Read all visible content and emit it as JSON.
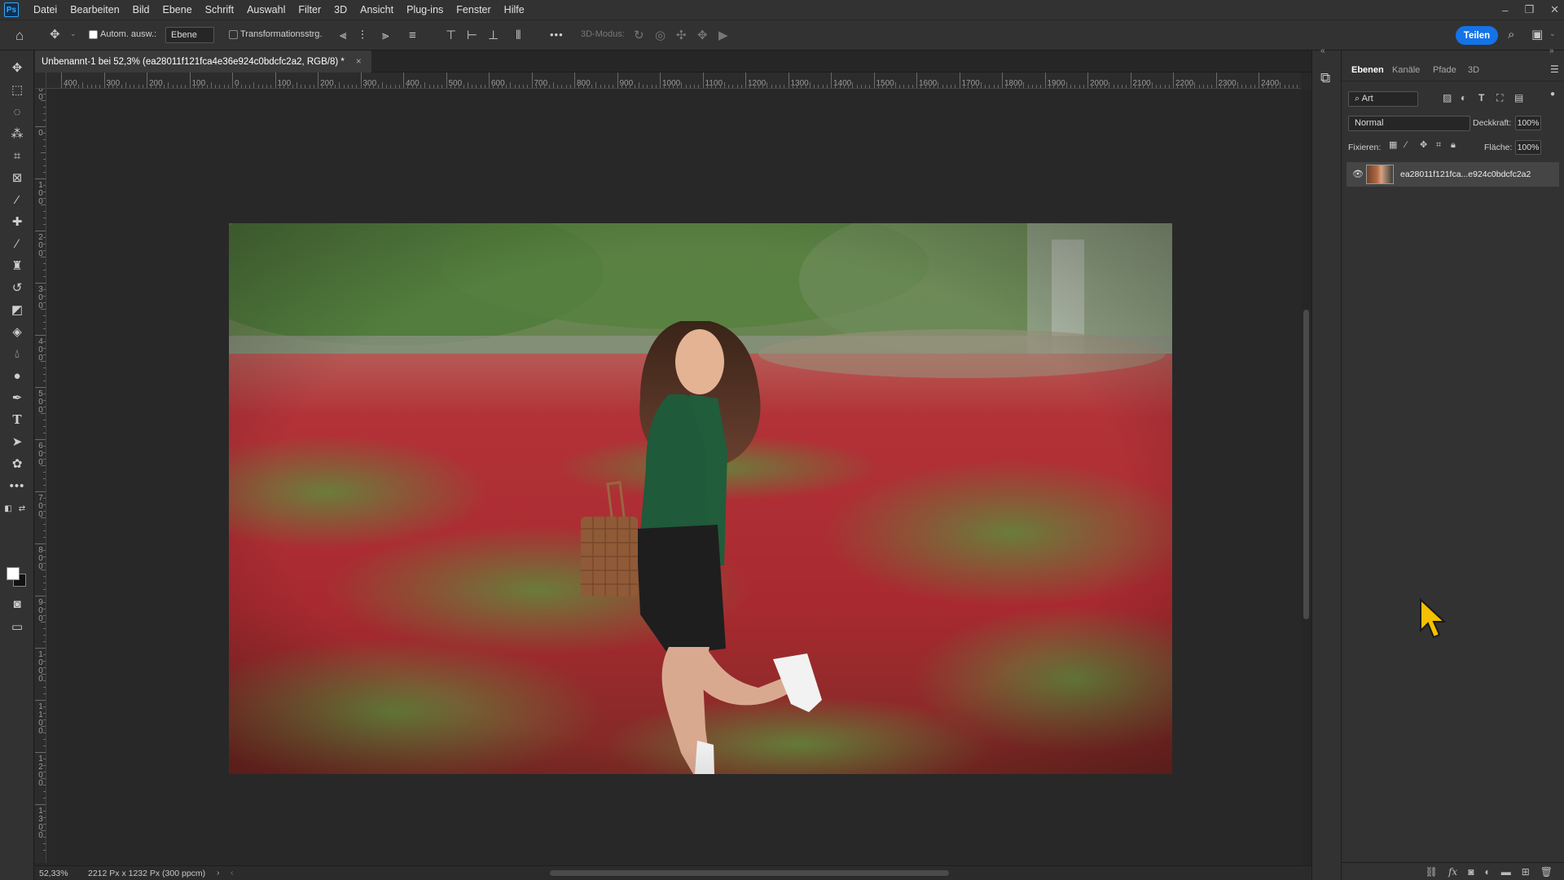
{
  "app": {
    "logo": "Ps"
  },
  "menu": [
    "Datei",
    "Bearbeiten",
    "Bild",
    "Ebene",
    "Schrift",
    "Auswahl",
    "Filter",
    "3D",
    "Ansicht",
    "Plug-ins",
    "Fenster",
    "Hilfe"
  ],
  "window_controls": {
    "minimize": "–",
    "restore": "❐",
    "close": "✕"
  },
  "options": {
    "auto_select_label": "Autom. ausw.:",
    "auto_select_checked": true,
    "auto_select_value": "Ebene",
    "transform_label": "Transformationsstrg.",
    "transform_checked": false,
    "more": "•••",
    "mode_3d_label": "3D-Modus:",
    "share_label": "Teilen"
  },
  "document": {
    "tab_title": "Unbenannt-1 bei 52,3% (ea28011f121fca4e36e924c0bdcfc2a2, RGB/8) *",
    "tab_close": "×",
    "zoom": "52,33%",
    "size_info": "2212 Px x 1232 Px (300 ppcm)"
  },
  "ruler": {
    "h_labels": [
      "400",
      "300",
      "200",
      "100",
      "0",
      "100",
      "200",
      "300",
      "400",
      "500",
      "600",
      "700",
      "800",
      "900",
      "1000",
      "1100",
      "1200",
      "1300",
      "1400",
      "1500",
      "1600",
      "1700",
      "1800",
      "1900",
      "2000",
      "2100",
      "2200",
      "2300",
      "2400"
    ],
    "v_labels": [
      "1 0 0",
      "0",
      "1 0 0",
      "2 0 0",
      "3 0 0",
      "4 0 0",
      "5 0 0",
      "6 0 0",
      "7 0 0",
      "8 0 0",
      "9 0 0",
      "1 0 0 0",
      "1 1 0 0",
      "1 2 0 0",
      "1 3 0 0"
    ]
  },
  "panel": {
    "tabs": [
      "Ebenen",
      "Kanäle",
      "Pfade",
      "3D"
    ],
    "active_tab": "Ebenen",
    "filter_label": "Art",
    "blend_mode": "Normal",
    "opacity_label": "Deckkraft:",
    "opacity_value": "100%",
    "lock_label": "Fixieren:",
    "fill_label": "Fläche:",
    "fill_value": "100%",
    "layers": [
      {
        "name": "ea28011f121fca...e924c0bdcfc2a2",
        "visible": true
      }
    ]
  },
  "colors": {
    "accent": "#1473e6",
    "ui_bg": "#323232",
    "canvas_bg": "#282828",
    "foreground": "#ffffff",
    "background": "#111111"
  },
  "tools": [
    "move-tool",
    "marquee-tool",
    "lasso-tool",
    "magic-wand-tool",
    "crop-tool",
    "frame-tool",
    "eyedropper-tool",
    "healing-brush-tool",
    "brush-tool",
    "clone-stamp-tool",
    "eraser-tool",
    "paint-bucket-tool",
    "dodge-tool",
    "blur-tool",
    "pen-tool",
    "type-tool",
    "path-selection-tool",
    "shape-tool",
    "more-tools"
  ]
}
